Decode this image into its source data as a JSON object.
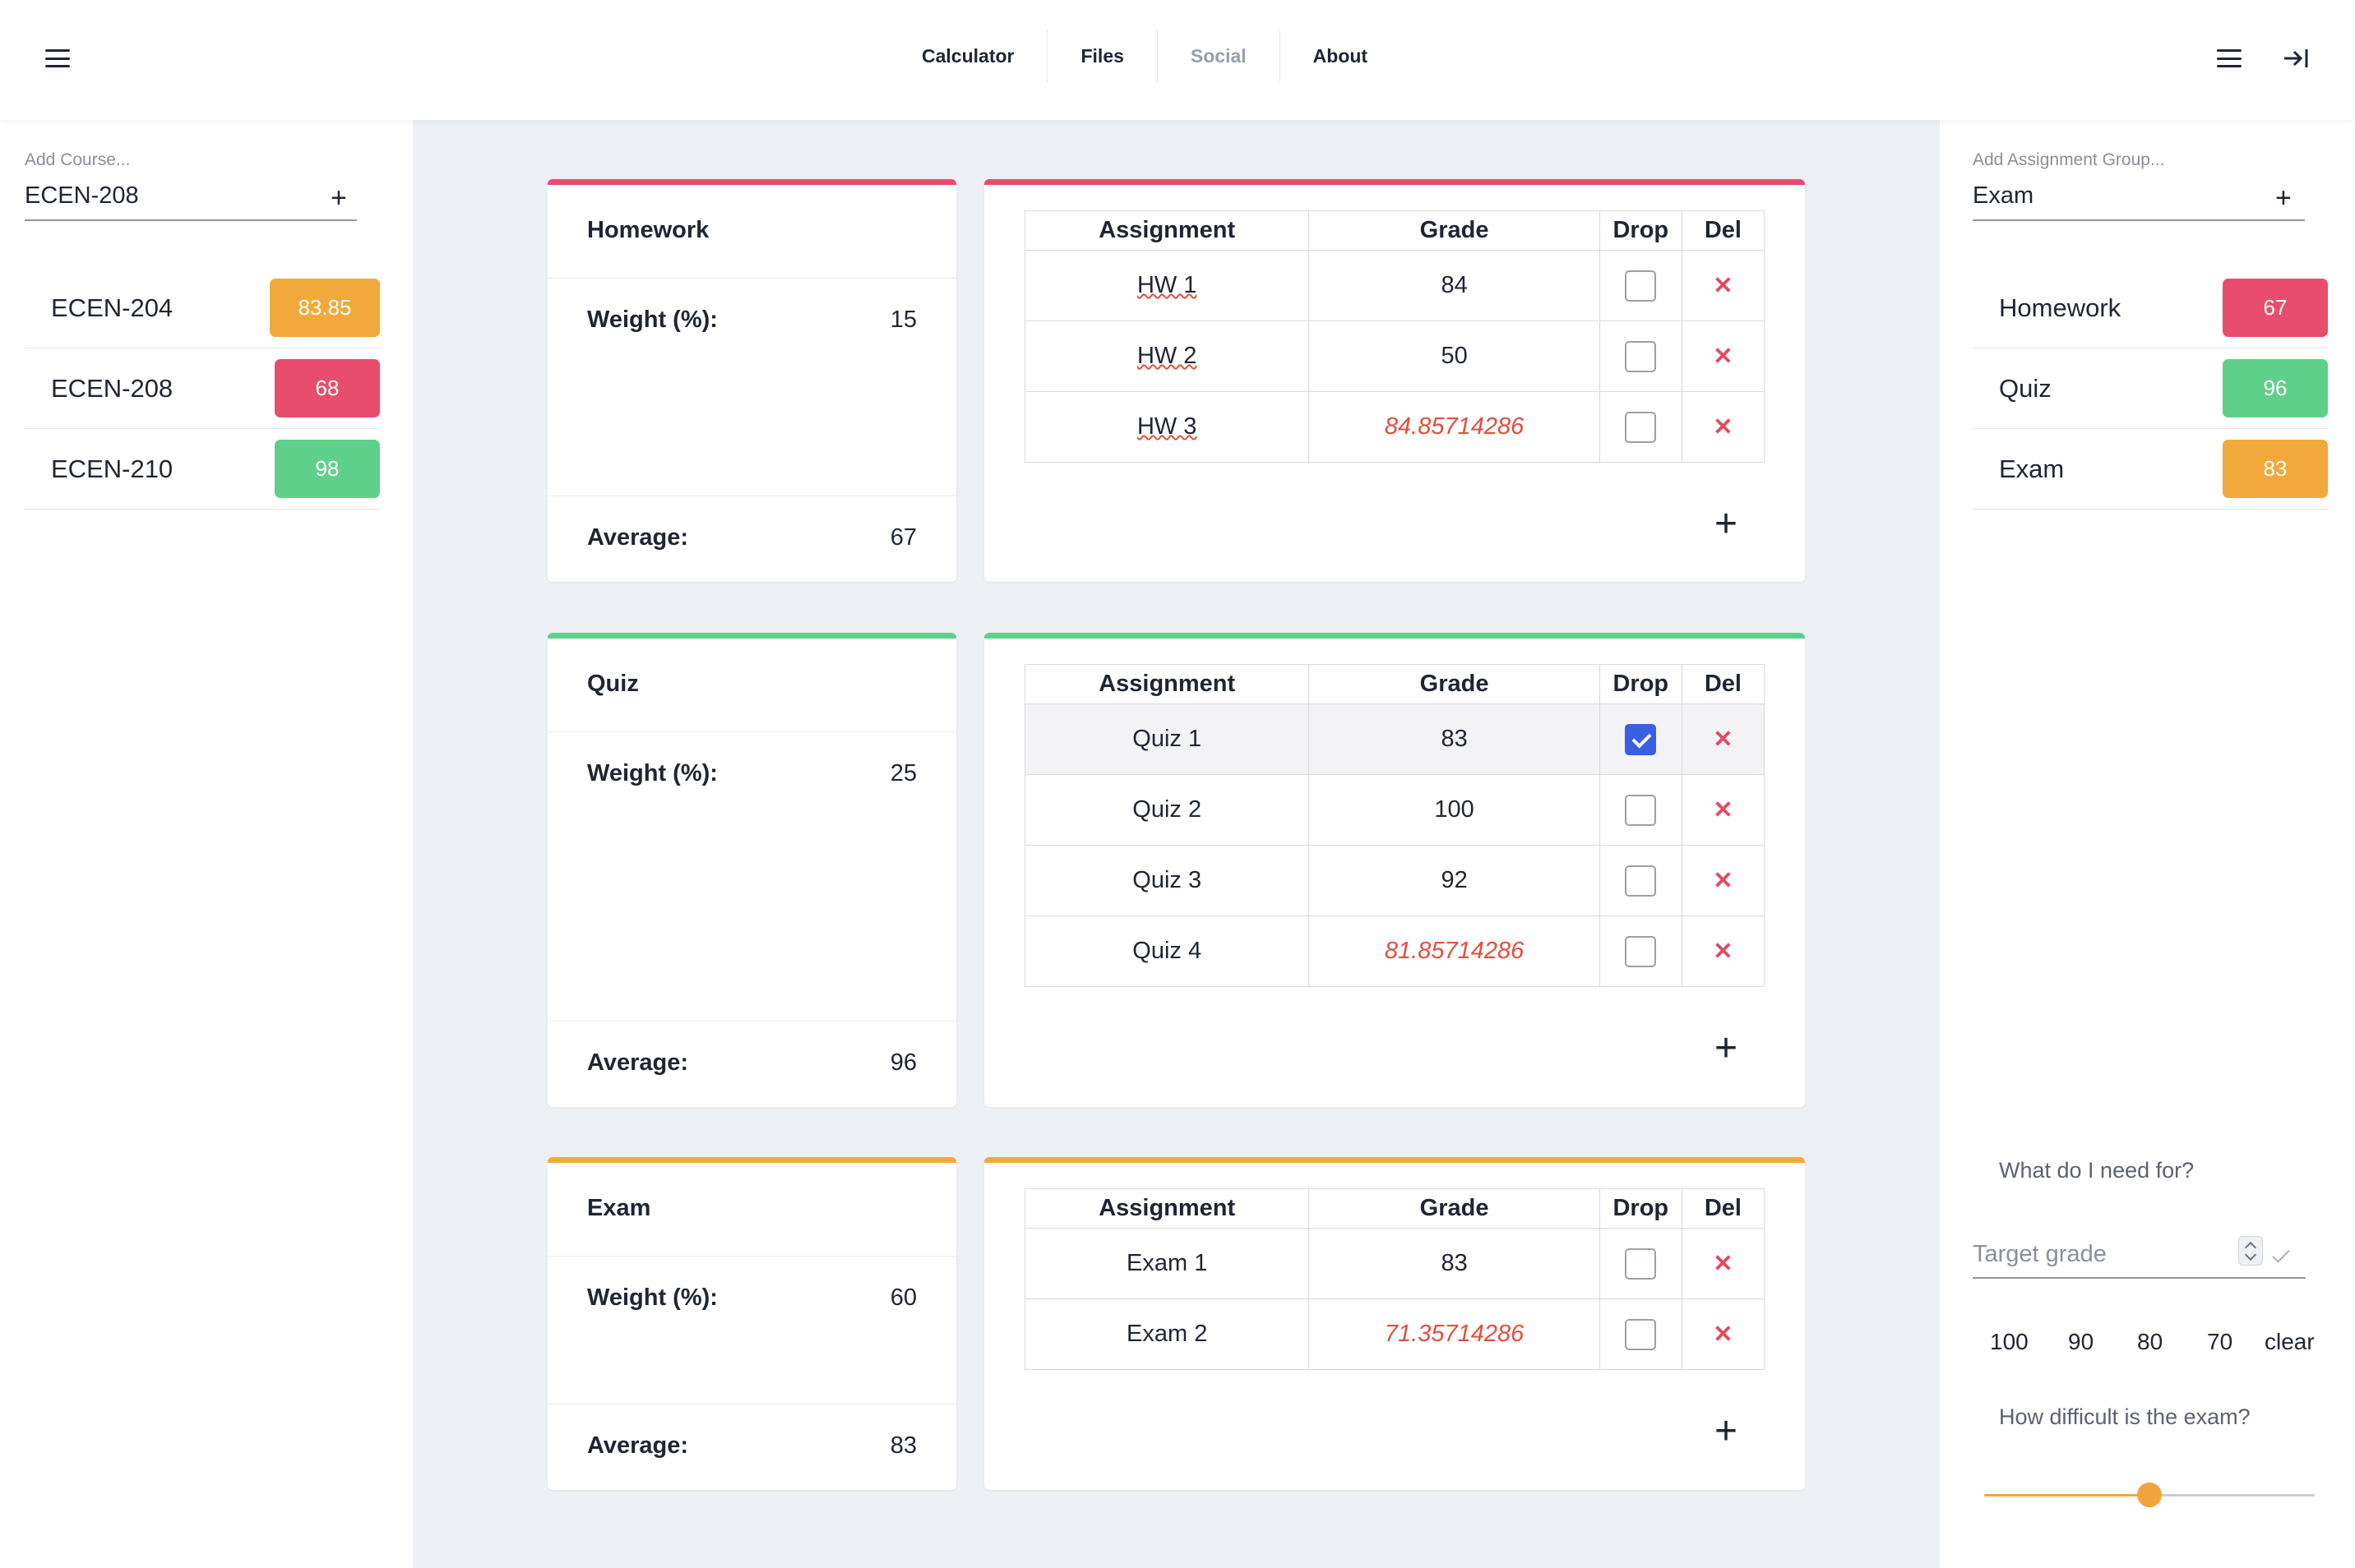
{
  "topbar": {
    "tabs": [
      {
        "label": "Calculator",
        "active": true
      },
      {
        "label": "Files",
        "active": true
      },
      {
        "label": "Social",
        "active": false
      },
      {
        "label": "About",
        "active": true
      }
    ]
  },
  "left": {
    "add_label": "Add Course...",
    "add_value": "ECEN-208",
    "add_icon": "+",
    "courses": [
      {
        "name": "ECEN-204",
        "grade": "83.85",
        "color": "#f2a93b"
      },
      {
        "name": "ECEN-208",
        "grade": "68",
        "color": "#e84d6b"
      },
      {
        "name": "ECEN-210",
        "grade": "98",
        "color": "#5fd08a"
      }
    ]
  },
  "right": {
    "add_label": "Add Assignment Group...",
    "add_value": "Exam",
    "add_icon": "+",
    "groups": [
      {
        "name": "Homework",
        "grade": "67",
        "color": "#e84d6b"
      },
      {
        "name": "Quiz",
        "grade": "96",
        "color": "#5fd08a"
      },
      {
        "name": "Exam",
        "grade": "83",
        "color": "#f2a93b"
      }
    ],
    "need_title": "What do I need for?",
    "target_placeholder": "Target grade",
    "quick": [
      "100",
      "90",
      "80",
      "70",
      "clear"
    ],
    "difficulty_title": "How difficult is the exam?",
    "difficulty_level": 0.5
  },
  "table_headers": {
    "assignment": "Assignment",
    "grade": "Grade",
    "drop": "Drop",
    "del": "Del"
  },
  "sections": [
    {
      "title": "Homework",
      "color": "#e84d6b",
      "weight_label": "Weight (%):",
      "weight": "15",
      "average_label": "Average:",
      "average": "67",
      "rows": [
        {
          "name": "HW 1",
          "grade": "84",
          "drop": false
        },
        {
          "name": "HW 2",
          "grade": "50",
          "drop": false
        },
        {
          "name": "HW 3",
          "grade": "84.85714286",
          "drop": false,
          "predicted": true
        }
      ]
    },
    {
      "title": "Quiz",
      "color": "#5fd08a",
      "weight_label": "Weight (%):",
      "weight": "25",
      "average_label": "Average:",
      "average": "96",
      "rows": [
        {
          "name": "Quiz 1",
          "grade": "83",
          "drop": true
        },
        {
          "name": "Quiz 2",
          "grade": "100",
          "drop": false
        },
        {
          "name": "Quiz 3",
          "grade": "92",
          "drop": false
        },
        {
          "name": "Quiz 4",
          "grade": "81.85714286",
          "drop": false,
          "predicted": true
        }
      ]
    },
    {
      "title": "Exam",
      "color": "#f2a93b",
      "weight_label": "Weight (%):",
      "weight": "60",
      "average_label": "Average:",
      "average": "83",
      "rows": [
        {
          "name": "Exam 1",
          "grade": "83",
          "drop": false
        },
        {
          "name": "Exam 2",
          "grade": "71.35714286",
          "drop": false,
          "predicted": true
        }
      ]
    }
  ],
  "icons": {
    "add": "+",
    "delete": "✕"
  }
}
